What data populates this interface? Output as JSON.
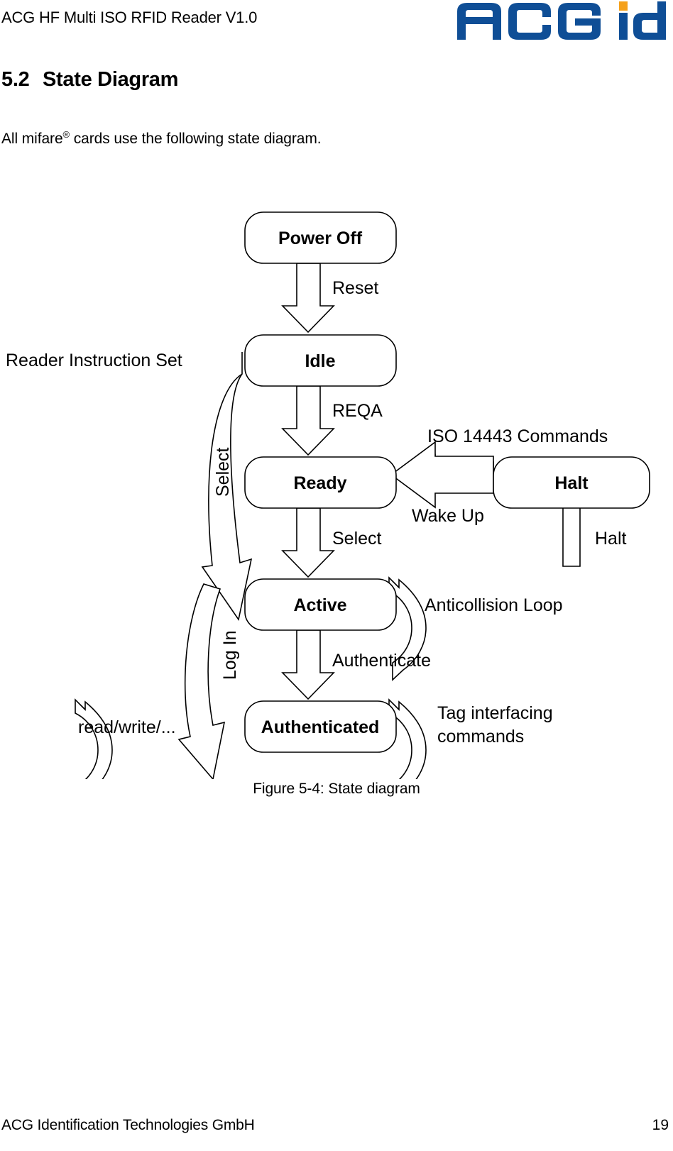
{
  "header": {
    "document_title": "ACG HF Multi ISO RFID Reader V1.0",
    "logo": {
      "text": "ACG id",
      "blue": "#0f4e96",
      "orange": "#f5a11b"
    }
  },
  "section": {
    "number": "5.2",
    "title": "State Diagram"
  },
  "intro": {
    "before": "All mifare",
    "superscript": "®",
    "after": " cards use the following state diagram."
  },
  "diagram": {
    "states": {
      "power_off": "Power Off",
      "idle": "Idle",
      "ready": "Ready",
      "active": "Active",
      "authenticated": "Authenticated",
      "halt": "Halt"
    },
    "transitions": {
      "reset": "Reset",
      "reqa": "REQA",
      "select_down": "Select",
      "authenticate": "Authenticate",
      "wake_up": "Wake Up",
      "halt": "Halt",
      "select_up": "Select",
      "log_in": "Log In"
    },
    "annotations": {
      "reader_instruction_set": "Reader Instruction Set",
      "iso_commands": "ISO 14443 Commands",
      "anticollision_loop": "Anticollision Loop",
      "tag_interfacing_line1": "Tag interfacing",
      "tag_interfacing_line2": "commands",
      "read_write": "read/write/..."
    }
  },
  "figure": {
    "caption": "Figure 5-4: State diagram"
  },
  "footer": {
    "company": "ACG Identification Technologies GmbH",
    "page_number": "19"
  }
}
